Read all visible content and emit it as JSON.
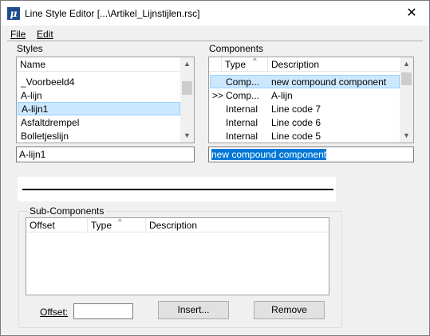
{
  "window": {
    "title": "Line Style Editor [...\\Artikel_Lijnstijlen.rsc]",
    "app_icon_glyph": "μ",
    "close_glyph": "✕"
  },
  "menu": {
    "file": "File",
    "edit": "Edit"
  },
  "styles": {
    "label": "Styles",
    "header": "Name",
    "items": [
      "_Voorbeeld4",
      "A-lijn",
      "A-lijn1",
      "Asfaltdrempel",
      "Bolletjeslijn"
    ],
    "selected_index": 2,
    "name_value": "A-lijn1"
  },
  "components": {
    "label": "Components",
    "headers": {
      "type": "Type",
      "description": "Description"
    },
    "rows": [
      {
        "marker": "",
        "type": "Comp...",
        "description": "new compound component"
      },
      {
        "marker": ">>",
        "type": "Comp...",
        "description": "A-lijn"
      },
      {
        "marker": "",
        "type": "Internal",
        "description": "Line code 7"
      },
      {
        "marker": "",
        "type": "Internal",
        "description": "Line code 6"
      },
      {
        "marker": "",
        "type": "Internal",
        "description": "Line code 5"
      }
    ],
    "selected_index": 0,
    "description_value": "new compound component"
  },
  "subcomponents": {
    "label": "Sub-Components",
    "headers": {
      "offset": "Offset",
      "type": "Type",
      "description": "Description"
    },
    "offset_label": "Offset:",
    "offset_value": "",
    "insert_label": "Insert...",
    "remove_label": "Remove"
  },
  "glyphs": {
    "up": "▲",
    "down": "▼",
    "sort": "^"
  },
  "colors": {
    "selection_bg": "#cce8ff",
    "selection_border": "#99d1ff",
    "text_highlight": "#0078d7"
  }
}
